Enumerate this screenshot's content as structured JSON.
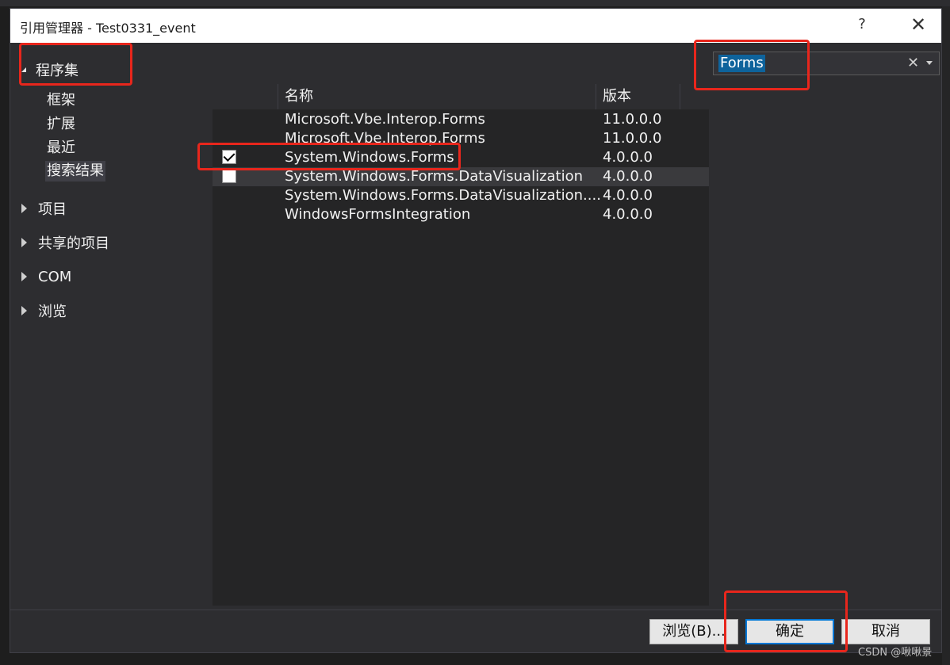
{
  "dialog": {
    "title": "引用管理器 - Test0331_event",
    "help": "?",
    "close": "✕"
  },
  "nav": {
    "assemblies": "程序集",
    "sub": [
      "框架",
      "扩展",
      "最近",
      "搜索结果"
    ],
    "groups": [
      "项目",
      "共享的项目",
      "COM",
      "浏览"
    ]
  },
  "search": {
    "value": "Forms",
    "clear": "✕"
  },
  "list": {
    "columns": {
      "name": "名称",
      "version": "版本"
    },
    "rows": [
      {
        "name": "Microsoft.Vbe.Interop.Forms",
        "version": "11.0.0.0",
        "checkbox": false,
        "checked": false
      },
      {
        "name": "Microsoft.Vbe.Interop.Forms",
        "version": "11.0.0.0",
        "checkbox": false,
        "checked": false
      },
      {
        "name": "System.Windows.Forms",
        "version": "4.0.0.0",
        "checkbox": true,
        "checked": true
      },
      {
        "name": "System.Windows.Forms.DataVisualization",
        "version": "4.0.0.0",
        "checkbox": true,
        "checked": false
      },
      {
        "name": "System.Windows.Forms.DataVisualization....",
        "version": "4.0.0.0",
        "checkbox": false,
        "checked": false
      },
      {
        "name": "WindowsFormsIntegration",
        "version": "4.0.0.0",
        "checkbox": false,
        "checked": false
      }
    ]
  },
  "buttons": {
    "browse": "浏览(B)...",
    "ok": "确定",
    "cancel": "取消"
  },
  "watermark": "CSDN @啾啾景",
  "colors": {
    "annotation": "#e8261c",
    "selection": "#0e639c",
    "primary_border": "#0078d7"
  }
}
